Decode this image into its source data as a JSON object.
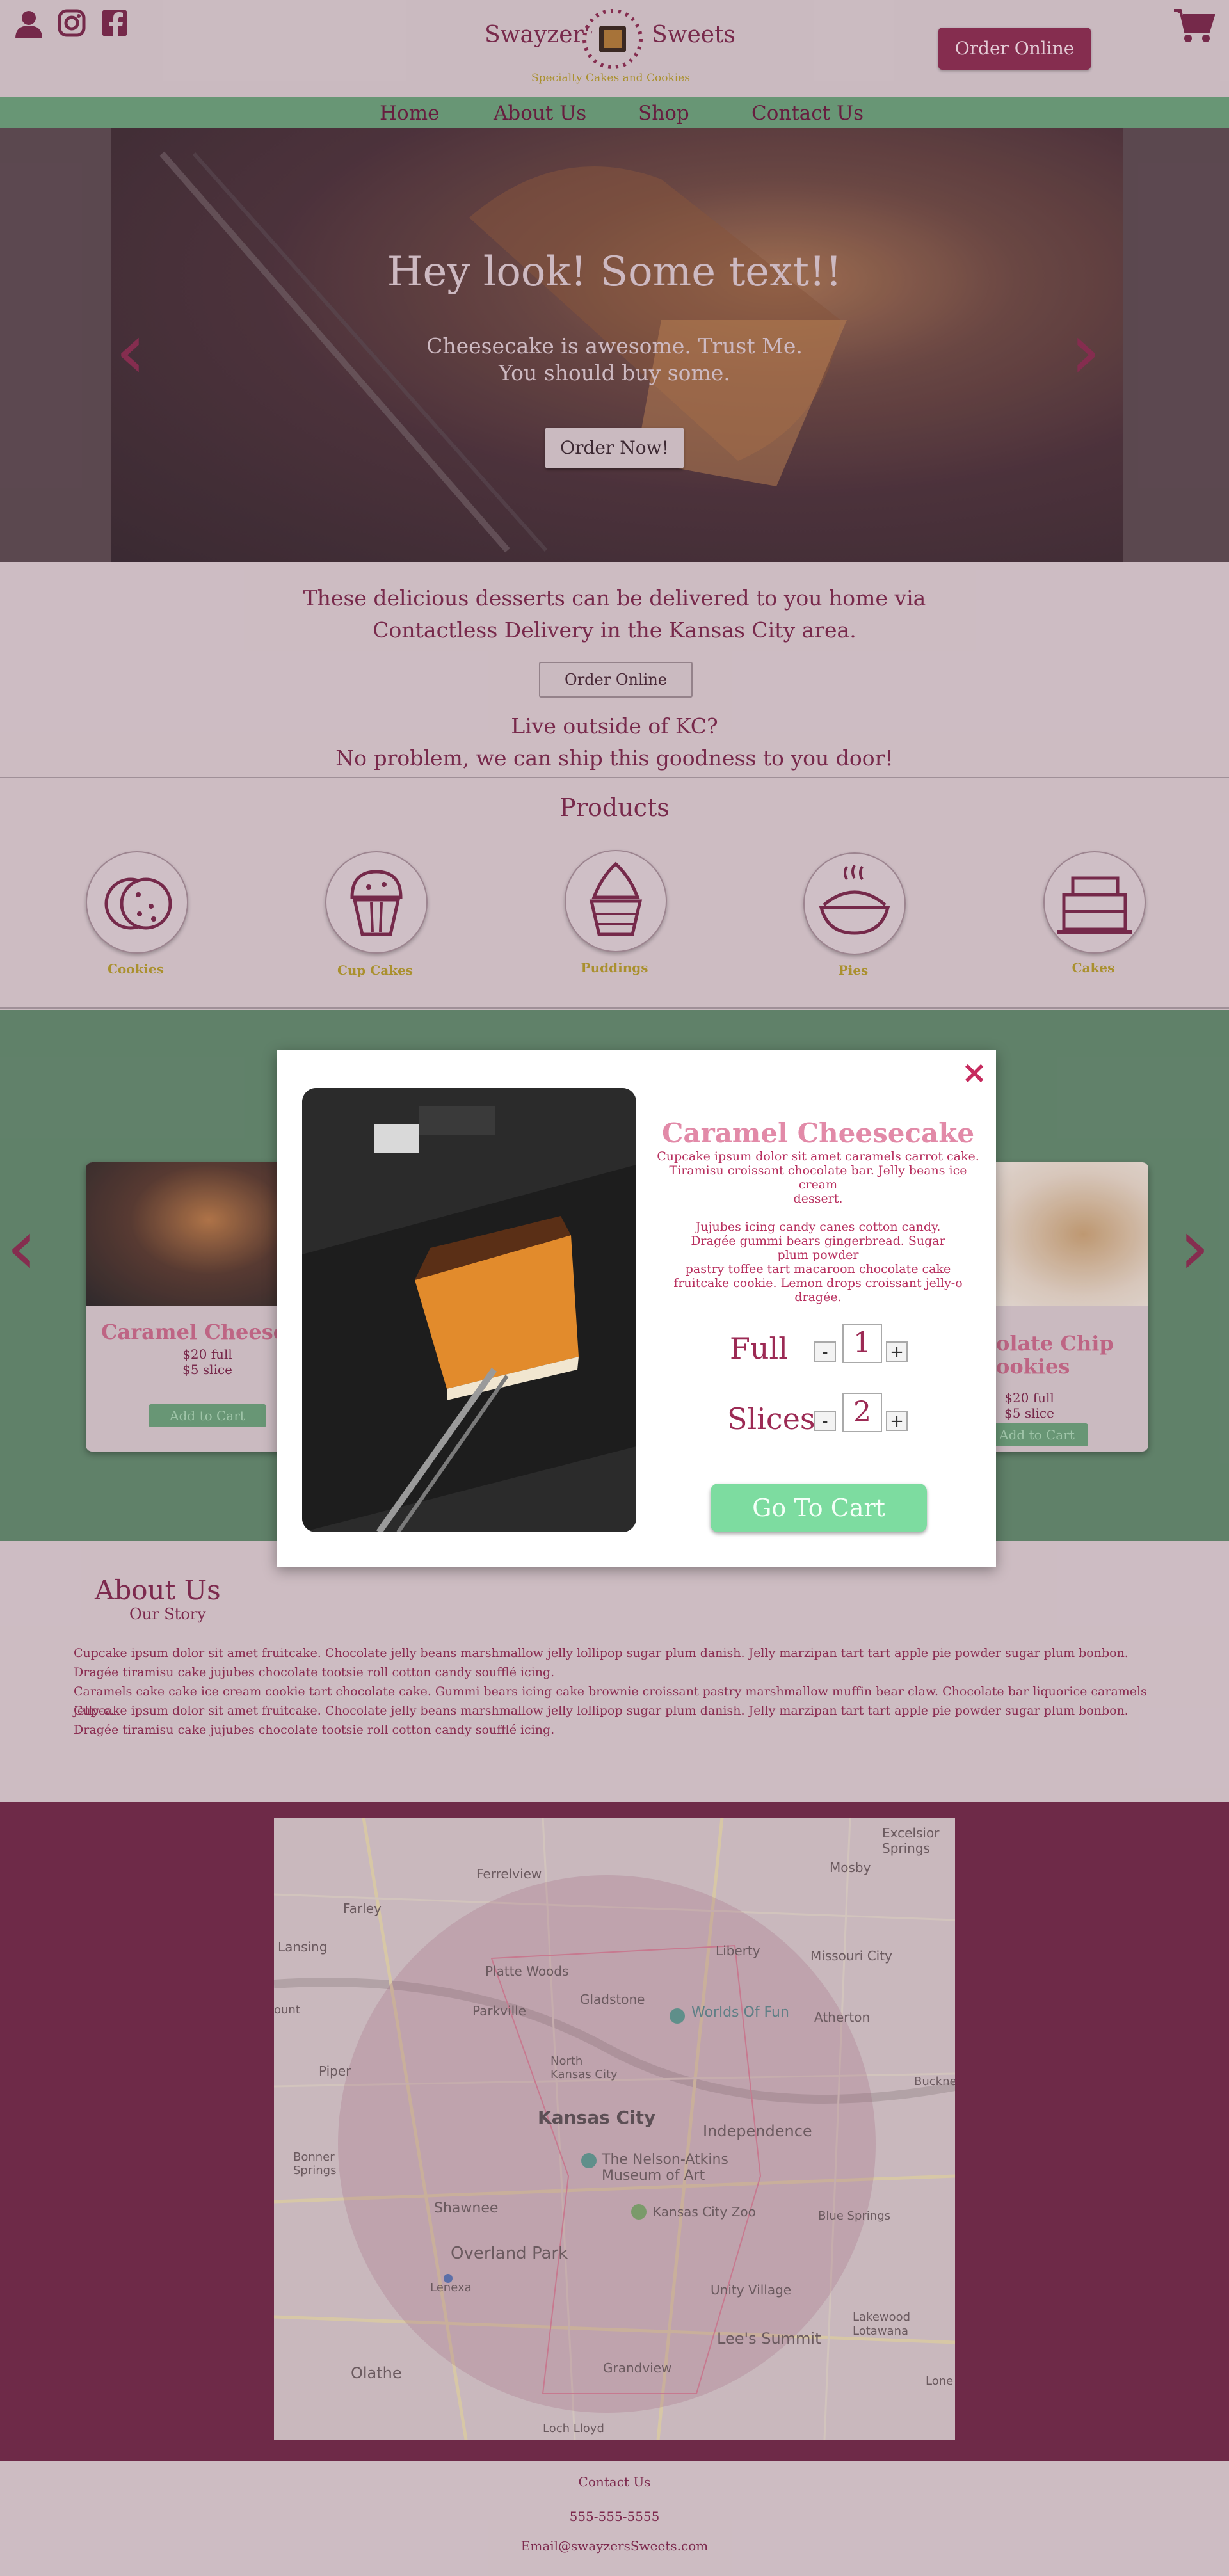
{
  "header": {
    "brand_left": "Swayzer's",
    "brand_right": "Sweets",
    "tagline": "Specialty Cakes and Cookies",
    "order_online": "Order Online"
  },
  "nav": [
    "Home",
    "About Us",
    "Shop",
    "Contact Us"
  ],
  "hero": {
    "title": "Hey look! Some text!!",
    "line1": "Cheesecake is awesome. Trust Me.",
    "line2": "You should buy some.",
    "button": "Order Now!"
  },
  "delivery": {
    "line1": "These delicious desserts can be delivered to you home via",
    "line2": "Contactless Delivery in the Kansas City area.",
    "button": "Order Online",
    "line3": "Live outside of KC?",
    "line4": "No problem, we can ship this goodness to you door!"
  },
  "products": {
    "title": "Products",
    "items": [
      "Cookies",
      "Cup Cakes",
      "Puddings",
      "Pies",
      "Cakes"
    ]
  },
  "cards": {
    "left": {
      "name": "Caramel Cheesec",
      "full": "$20 full",
      "slice": "$5 slice",
      "button": "Add to Cart"
    },
    "right": {
      "name1": "olate Chip",
      "name2": "ookies",
      "full": "$20 full",
      "slice": "$5 slice",
      "button": "Add to Cart"
    }
  },
  "modal": {
    "title": "Caramel Cheesecake",
    "desc1": [
      "Cupcake ipsum dolor sit amet caramels carrot cake.",
      "Tiramisu croissant chocolate bar. Jelly beans ice cream",
      "dessert."
    ],
    "desc2": [
      "Jujubes icing candy canes cotton candy.",
      "Dragée gummi bears gingerbread. Sugar",
      "plum powder",
      "pastry toffee tart macaroon chocolate cake",
      "fruitcake cookie. Lemon drops croissant jelly-o dragée."
    ],
    "full_label": "Full",
    "full_qty": "1",
    "slices_label": "Slices",
    "slices_qty": "2",
    "minus": "-",
    "plus": "+",
    "go_to_cart": "Go To Cart",
    "close": "×"
  },
  "about": {
    "title": "About Us",
    "subtitle": "Our Story",
    "p1": "Cupcake ipsum dolor sit amet fruitcake. Chocolate jelly beans marshmallow jelly lollipop sugar plum danish.  Jelly marzipan tart tart apple pie powder sugar plum bonbon. Dragée tiramisu cake jujubes chocolate tootsie roll cotton candy soufflé icing.",
    "p2": "Caramels cake cake ice cream cookie tart chocolate cake. Gummi bears icing cake brownie croissant pastry marshmallow muffin bear claw. Chocolate bar liquorice caramels jelly-o.",
    "p3": "Cupcake ipsum dolor sit amet fruitcake. Chocolate jelly beans marshmallow jelly lollipop sugar plum danish.  Jelly marzipan tart tart apple pie powder sugar plum bonbon. Dragée tiramisu cake jujubes chocolate tootsie roll cotton candy soufflé icing."
  },
  "map": {
    "labels": [
      "Excelsior Springs",
      "Mosby",
      "Ferrelview",
      "Farley",
      "Liberty",
      "Missouri City",
      "Lansing",
      "Platte Woods",
      "Gladstone",
      "Worlds Of Fun",
      "Parkville",
      "Atherton",
      "North Kansas City",
      "Piper",
      "Kansas City",
      "Independence",
      "Bonner Springs",
      "The Nelson-Atkins Museum of Art",
      "Kansas City Zoo",
      "Blue Springs",
      "Shawnee",
      "Overland Park",
      "Lenexa",
      "Unity Village",
      "Lee's Summit",
      "Lakewood",
      "Lotawana",
      "Olathe",
      "Grandview",
      "Loch Lloyd",
      "Buckne",
      "ount",
      "Lone"
    ]
  },
  "footer": {
    "contact": "Contact Us",
    "phone": "555-555-5555",
    "email": "Email@swayzersSweets.com"
  },
  "colors": {
    "brand": "#8b2e52",
    "nav_green": "#6ca07b",
    "modal_title": "#e28aa8",
    "go_to_cart": "#7ddca0",
    "gold": "#b39a2e"
  }
}
